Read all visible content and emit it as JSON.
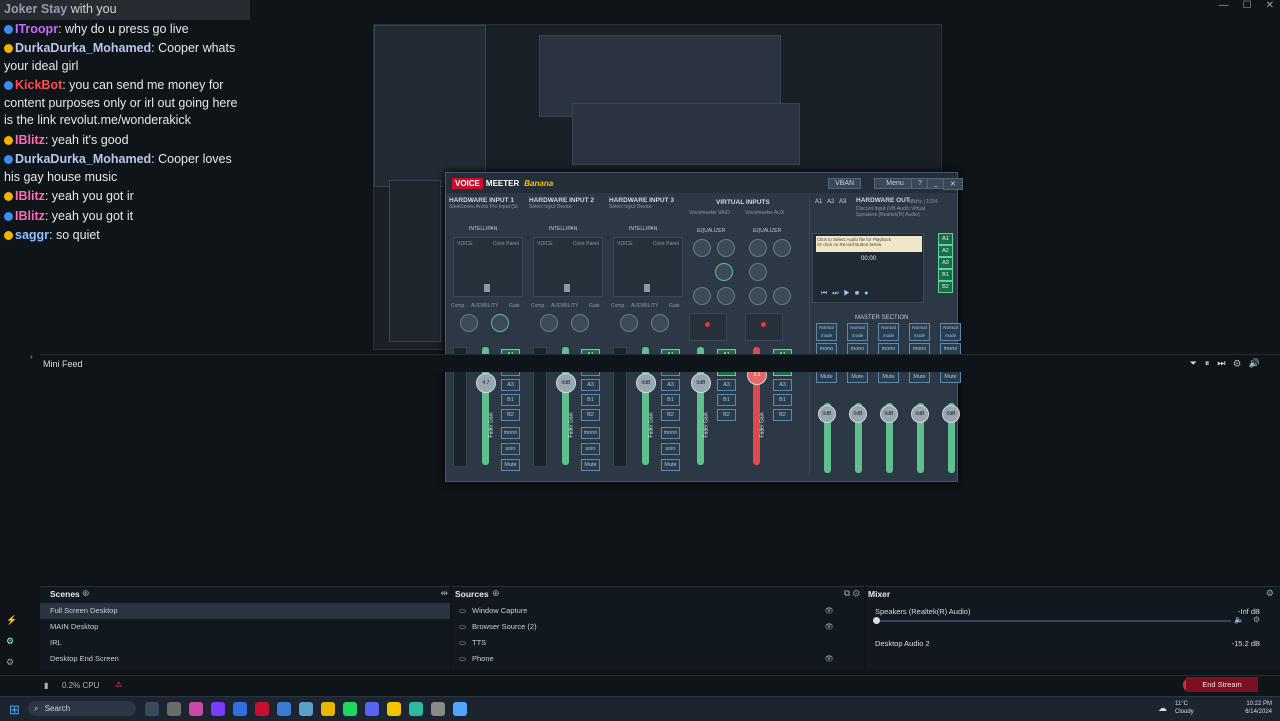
{
  "chat": {
    "top_partial": {
      "user": "Joker Stay",
      "text": " with you"
    },
    "messages": [
      {
        "user": "ITroopr",
        "user_color": "#c76bff",
        "text": ": why do u press go live"
      },
      {
        "user": "DurkaDurka_Mohamed",
        "user_color": "#b8c6f0",
        "text": ": Cooper whats your ideal girl"
      },
      {
        "user": "KickBot",
        "user_color": "#ff4b4b",
        "text": ": you can send me money for content purposes only or irl out going here is the link revolut.me/wonderakick"
      },
      {
        "user": "IBlitz",
        "user_color": "#ff6bb5",
        "text": ": yeah it's good"
      },
      {
        "user": "DurkaDurka_Mohamed",
        "user_color": "#b8c6f0",
        "text": ": Cooper loves his gay house music"
      },
      {
        "user": "IBlitz",
        "user_color": "#ff6bb5",
        "text": ": yeah you got ir"
      },
      {
        "user": "IBlitz",
        "user_color": "#ff6bb5",
        "text": ": yeah you got it"
      },
      {
        "user": "saggr",
        "user_color": "#8fbfff",
        "text": ": so quiet"
      }
    ]
  },
  "voicemeeter": {
    "brand_voice": "VOICE",
    "brand_meeter": "MEETER",
    "brand_banana": "Banana",
    "vban": "VBAN",
    "menu": "Menu",
    "strips": [
      {
        "name": "HARDWARE INPUT 1",
        "device": "SteelSeries Arctis Pro Input (SI",
        "panel": "INTELLIPAN",
        "gain": "4.7"
      },
      {
        "name": "HARDWARE INPUT 2",
        "device": "Select Input Device",
        "panel": "INTELLIPAN",
        "gain": "0dB"
      },
      {
        "name": "HARDWARE INPUT 3",
        "device": "Select Input Device",
        "panel": "INTELLIPAN",
        "gain": "0dB"
      }
    ],
    "virtual_inputs": "VIRTUAL INPUTS",
    "virtual_strips": [
      {
        "name": "Voicemeeter VAIO",
        "eq": "EQUALIZER",
        "gain": "0dB"
      },
      {
        "name": "Voicemeeter AUX",
        "eq": "EQUALIZER",
        "gain": "3.1"
      }
    ],
    "hardware_out": "HARDWARE OUT",
    "hardware_out_info": "48kHz | 1024",
    "hardware_out_device": "Discord Input (VB-Audio Virtual",
    "hardware_out_device2": "Speakers (Realtek(R) Audio)",
    "cassette_line1": "Click to Select Audio file for Playback",
    "cassette_line2": "Or click on Record Button below",
    "cassette_time": "00:00",
    "master_section": "MASTER SECTION",
    "master_gain": "0dB",
    "normal_mode": "Normal mode",
    "fader_label": "Fader Gain",
    "bus_labels": [
      "A1",
      "A2",
      "A3",
      "B1",
      "B2"
    ],
    "mono": "mono",
    "mute": "Mute",
    "eq": "EQ",
    "solo": "solo",
    "color_panel": "Color Panel",
    "voice": "VOICE",
    "comp": "Comp.",
    "audibility": "AUDIBILITY",
    "gate": "Gate"
  },
  "minifeed": {
    "title": "Mini Feed"
  },
  "scenes": {
    "title": "Scenes",
    "items": [
      "Full Screen Desktop",
      "MAIN Desktop",
      "IRL",
      "Desktop End Screen"
    ]
  },
  "sources": {
    "title": "Sources",
    "items": [
      "Window Capture",
      "Browser Source (2)",
      "TTS",
      "Phone"
    ]
  },
  "mixer": {
    "title": "Mixer",
    "items": [
      {
        "name": "Speakers (Realtek(R) Audio)",
        "level": "-Inf dB"
      },
      {
        "name": "Desktop Audio 2",
        "level": "-15.2 dB"
      }
    ]
  },
  "status": {
    "cpu": "0.2% CPU",
    "end_stream": "End Stream"
  },
  "taskbar": {
    "search": "Search",
    "weather_temp": "11°C",
    "weather_desc": "Cloudy",
    "time": "10:22 PM",
    "date": "6/14/2024"
  },
  "colors": {
    "accent": "#5fc08d",
    "record": "#c8102e",
    "brand_yellow": "#f5c400"
  }
}
